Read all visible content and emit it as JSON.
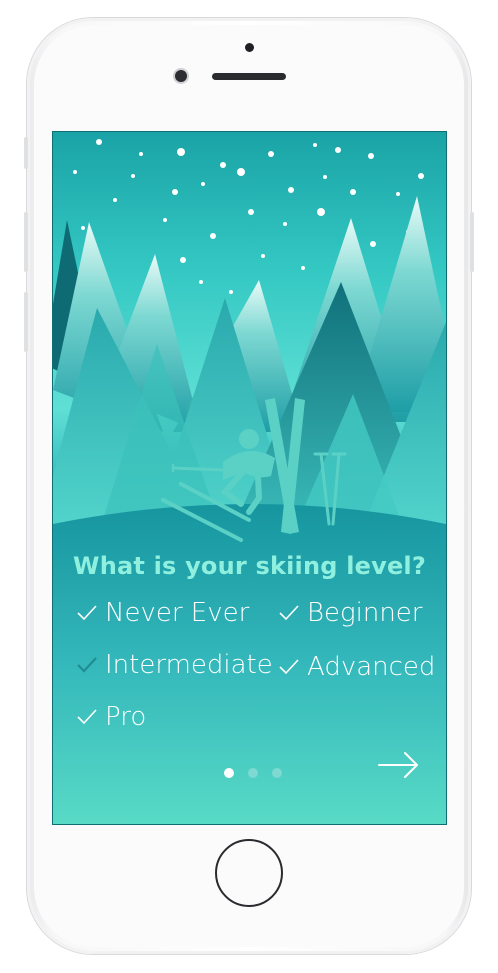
{
  "onboarding": {
    "question": "What is your skiing level?",
    "options": [
      {
        "label": "Never Ever",
        "checked": false
      },
      {
        "label": "Beginner",
        "checked": false
      },
      {
        "label": "Intermediate",
        "checked": true
      },
      {
        "label": "Advanced",
        "checked": false
      },
      {
        "label": "Pro",
        "checked": false
      }
    ],
    "pager": {
      "total": 3,
      "active": 1
    },
    "next_icon": "arrow-right-icon"
  },
  "colors": {
    "question_text": "#8ff0df",
    "option_text": "#ffffff",
    "check_default": "#ffffff",
    "check_selected": "#1f8e93",
    "dot_active": "#ffffff",
    "dot_inactive": "#7ed9d2"
  }
}
